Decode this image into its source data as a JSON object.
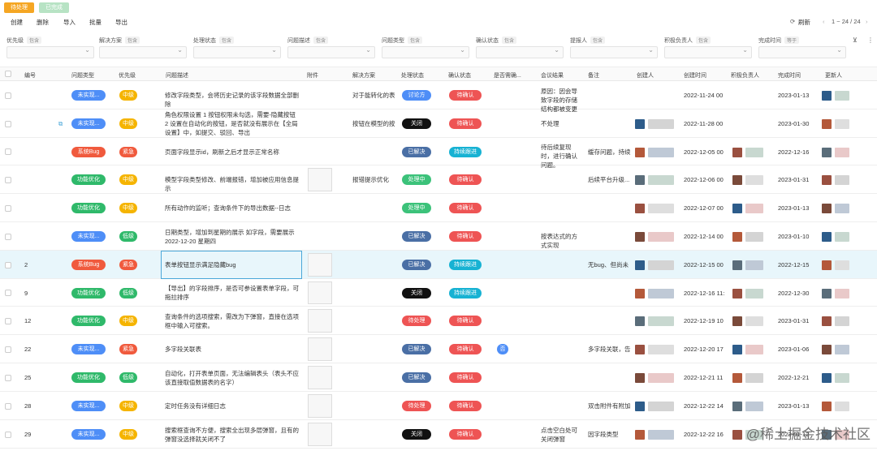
{
  "tabs": {
    "todo": "待处理",
    "done": "已完成"
  },
  "toolbar": {
    "create": "创建",
    "delete": "删除",
    "import": "导入",
    "batch": "批量",
    "export": "导出",
    "refresh": "刷新",
    "pagination": "1 ~ 24 / 24"
  },
  "filters": [
    {
      "label": "优先级",
      "chip": "包含"
    },
    {
      "label": "解决方案",
      "chip": "包含"
    },
    {
      "label": "处理状态",
      "chip": "包含"
    },
    {
      "label": "问题描述",
      "chip": "包含"
    },
    {
      "label": "问题类型",
      "chip": "包含"
    },
    {
      "label": "确认状态",
      "chip": "包含"
    },
    {
      "label": "提报人",
      "chip": "包含"
    },
    {
      "label": "积极负责人",
      "chip": "包含"
    },
    {
      "label": "完成时间",
      "chip": "等于"
    }
  ],
  "columns": [
    "编号",
    "问题类型",
    "优先级",
    "问题描述",
    "附件",
    "解决方案",
    "处理状态",
    "确认状态",
    "是否需确...",
    "会议结果",
    "备注",
    "创建人",
    "创建时间",
    "积极负责人",
    "完成时间",
    "更新人"
  ],
  "colors": {
    "type_blue": "#4e8ef7",
    "type_green": "#2fb96a",
    "type_red": "#f05a3d",
    "prio_yellow": "#f5b400",
    "prio_red": "#f05a3d",
    "prio_green": "#2fb96a",
    "status_darkblue": "#4a6fa5",
    "status_black": "#111111",
    "status_green": "#3cc27a",
    "status_red": "#ee5454",
    "confirm_red": "#ee5454",
    "confirm_cyan": "#17b2d3"
  },
  "rows": [
    {
      "id": "",
      "type": "未实现...",
      "prio": "中级",
      "desc": "修改字段类型，会将历史记录的该字段数据全部删除",
      "solution": "对于能转化的表",
      "status": "讨论方",
      "confirm": "待确认",
      "need": "",
      "meeting": "原因：因会导致字段的存储结构都被变更",
      "remark": "",
      "created": "2022-11-24 00",
      "finish": "2023-01-13"
    },
    {
      "id": "",
      "type": "未实现...",
      "prio": "中级",
      "desc": "角色权限设置 1 按钮权限未勾选，需要-隐藏按钮 2 设置在自动化的按钮，是否就没有展示在【全局设置】中，如提交、驳回、导出",
      "solution": "按钮在模型的按",
      "status": "关闭",
      "confirm": "待确认",
      "need": "",
      "meeting": "不处理",
      "remark": "",
      "created": "2022-11-28 00",
      "finish": "2023-01-30"
    },
    {
      "id": "",
      "type": "系统Bug",
      "prio": "紧急",
      "desc": "页面字段显示id，刷新之后才显示正常名称",
      "solution": "",
      "status": "已解决",
      "confirm": "持续跟进",
      "need": "",
      "meeting": "待后续复现时，进行确认问题。",
      "remark": "缓存问题，持续",
      "created": "2022-12-05 00",
      "finish": "2022-12-16"
    },
    {
      "id": "",
      "type": "功能优化",
      "prio": "中级",
      "desc": "模型字段类型修改、前端报错，增加被应用信息提示",
      "solution": "报错提示优化",
      "status": "处理中",
      "confirm": "待确认",
      "need": "",
      "meeting": "",
      "remark": "后续平台升级...",
      "created": "2022-12-06 00",
      "finish": "2023-01-31"
    },
    {
      "id": "",
      "type": "功能优化",
      "prio": "中级",
      "desc": "所有动作的监听；查询条件下的导出数据--日志",
      "solution": "",
      "status": "处理中",
      "confirm": "待确认",
      "need": "",
      "meeting": "",
      "remark": "",
      "created": "2022-12-07 00",
      "finish": "2023-01-13"
    },
    {
      "id": "",
      "type": "未实现...",
      "prio": "低级",
      "desc": "日期类型，增加到星期的展示 如字段，需要展示2022-12-20 星期四",
      "solution": "",
      "status": "已解决",
      "confirm": "待确认",
      "need": "",
      "meeting": "按表达式的方式实现",
      "remark": "",
      "created": "2022-12-14 00",
      "finish": "2023-01-10"
    },
    {
      "id": "2",
      "type": "系统Bug",
      "prio": "紧急",
      "desc": "表单按钮显示满足隐藏bug",
      "solution": "",
      "status": "已解决",
      "confirm": "持续跟进",
      "need": "",
      "meeting": "",
      "remark": "无bug、但尚未",
      "created": "2022-12-15 00",
      "finish": "2022-12-15"
    },
    {
      "id": "9",
      "type": "功能优化",
      "prio": "低级",
      "desc": "【导出】的字段排序，是否可参设置表单字段，可拖拉排序",
      "solution": "",
      "status": "关闭",
      "confirm": "持续跟进",
      "need": "",
      "meeting": "",
      "remark": "",
      "created": "2022-12-16 11:",
      "finish": "2022-12-30"
    },
    {
      "id": "12",
      "type": "功能优化",
      "prio": "中级",
      "desc": "查询条件的选项搜索，需改为下弹窗，直接在选项框中输入可搜索。",
      "solution": "",
      "status": "待处理",
      "confirm": "待确认",
      "need": "",
      "meeting": "",
      "remark": "",
      "created": "2022-12-19 10",
      "finish": "2023-01-31"
    },
    {
      "id": "22",
      "type": "未实现...",
      "prio": "紧急",
      "desc": "多字段关联表",
      "solution": "",
      "status": "已解决",
      "confirm": "待确认",
      "need": "否",
      "meeting": "",
      "remark": "多字段关联，告",
      "created": "2022-12-20 17",
      "finish": "2023-01-06"
    },
    {
      "id": "25",
      "type": "功能优化",
      "prio": "低级",
      "desc": "自动化，打开表单页面，无法编辑表头（表头不应该直接取值数据表的名字）",
      "solution": "",
      "status": "已解决",
      "confirm": "待确认",
      "need": "",
      "meeting": "",
      "remark": "",
      "created": "2022-12-21 11",
      "finish": "2022-12-21"
    },
    {
      "id": "28",
      "type": "未实现...",
      "prio": "中级",
      "desc": "定时任务没有详细日志",
      "solution": "",
      "status": "待处理",
      "confirm": "待确认",
      "need": "",
      "meeting": "",
      "remark": "双击附件有附加",
      "created": "2022-12-22 14",
      "finish": "2023-01-13"
    },
    {
      "id": "29",
      "type": "未实现...",
      "prio": "中级",
      "desc": "搜索框查询不方便，搜索全出现多层弹窗，且有的弹窗没选择就关闭不了",
      "solution": "",
      "status": "关闭",
      "confirm": "待确认",
      "need": "",
      "meeting": "点击空白处可关闭弹窗",
      "remark": "因字段类型",
      "created": "2022-12-22 16",
      "finish": "2023-01-12"
    }
  ],
  "watermark": "@稀土掘金技术社区"
}
